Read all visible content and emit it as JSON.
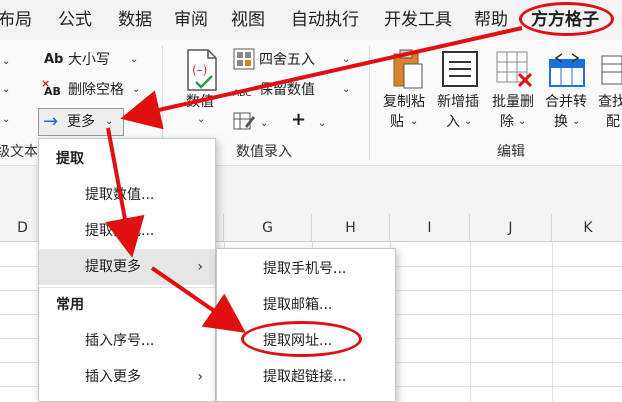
{
  "menu_tabs": [
    "布局",
    "公式",
    "数据",
    "审阅",
    "视图",
    "自动执行",
    "开发工具",
    "帮助",
    "方方格子"
  ],
  "ribbon": {
    "text_group": {
      "case_label": "大小写",
      "delete_space_label": "删除空格",
      "more_label": "更多",
      "group_label": "级文本"
    },
    "number_group": {
      "value_label": "数值",
      "round_label": "四舍五入",
      "keep_value_label": "保留数值",
      "plus_label": "+",
      "group_label": "数值录入"
    },
    "edit_group": {
      "copy_paste_line1": "复制粘",
      "copy_paste_line2": "贴",
      "new_insert_line1": "新增插",
      "new_insert_line2": "入",
      "batch_delete_line1": "批量删",
      "batch_delete_line2": "除",
      "merge_convert_line1": "合并转",
      "merge_convert_line2": "换",
      "find_line1": "查找",
      "find_line2": "配",
      "group_label": "编辑"
    }
  },
  "columns": [
    "D",
    "G",
    "H",
    "I",
    "J",
    "K"
  ],
  "more_menu": {
    "section_extract": "提取",
    "extract_value": "提取数值...",
    "extract_formula": "提取算式...",
    "extract_more": "提取更多",
    "section_common": "常用",
    "insert_serial": "插入序号...",
    "insert_more": "插入更多"
  },
  "submenu": {
    "extract_phone": "提取手机号...",
    "extract_email": "提取邮箱...",
    "extract_url": "提取网址...",
    "extract_hyperlink": "提取超链接..."
  },
  "colors": {
    "annotation_red": "#e01010",
    "icon_blue": "#1e6fd9",
    "icon_orange": "#d9822b",
    "icon_green": "#2e9b4e"
  }
}
